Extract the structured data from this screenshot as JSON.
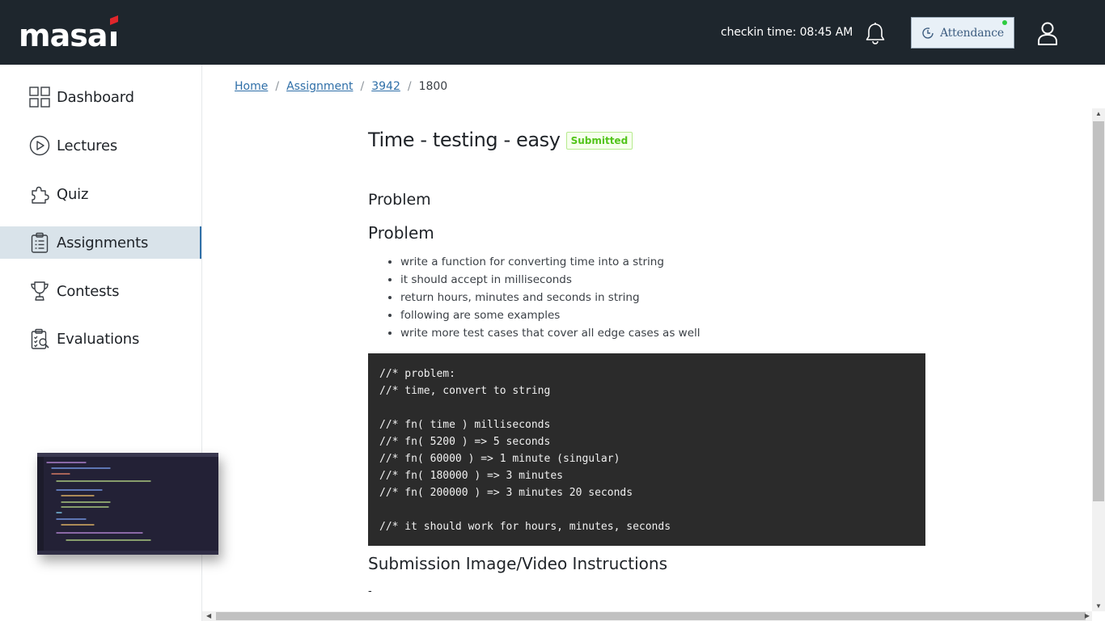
{
  "header": {
    "logo_text": "masai",
    "checkin_text": "checkin time: 08:45 AM",
    "attendance_label": "Attendance",
    "icons": [
      "bell-icon",
      "clock-icon",
      "user-icon"
    ]
  },
  "sidebar": {
    "items": [
      {
        "label": "Dashboard",
        "icon": "grid-icon"
      },
      {
        "label": "Lectures",
        "icon": "play-circle-icon"
      },
      {
        "label": "Quiz",
        "icon": "puzzle-icon"
      },
      {
        "label": "Assignments",
        "icon": "clipboard-icon",
        "active": true
      },
      {
        "label": "Contests",
        "icon": "trophy-icon"
      },
      {
        "label": "Evaluations",
        "icon": "evaluation-icon"
      }
    ]
  },
  "breadcrumb": {
    "home": "Home",
    "assignment": "Assignment",
    "id1": "3942",
    "current": "1800",
    "separator": "/"
  },
  "assignment": {
    "title": "Time - testing - easy",
    "status": "Submitted",
    "section_heading": "Problem",
    "problem_heading": "Problem",
    "bullets": [
      "write a function for converting time into a string",
      "it should accept in milliseconds",
      "return hours, minutes and seconds in string",
      "following are some examples",
      "write more test cases that cover all edge cases as well"
    ],
    "code": "//* problem:\n//* time, convert to string\n\n//* fn( time ) milliseconds\n//* fn( 5200 ) => 5 seconds\n//* fn( 60000 ) => 1 minute (singular)\n//* fn( 180000 ) => 3 minutes\n//* fn( 200000 ) => 3 minutes 20 seconds\n\n//* it should work for hours, minutes, seconds",
    "submission_heading": "Submission Image/Video Instructions",
    "submission_text": "-"
  },
  "colors": {
    "header_bg": "#1e262d",
    "accent": "#2f6fa8",
    "active_nav_bg": "#d9e3ea",
    "badge_green": "#52c41a",
    "code_bg": "#2b2b2b"
  }
}
